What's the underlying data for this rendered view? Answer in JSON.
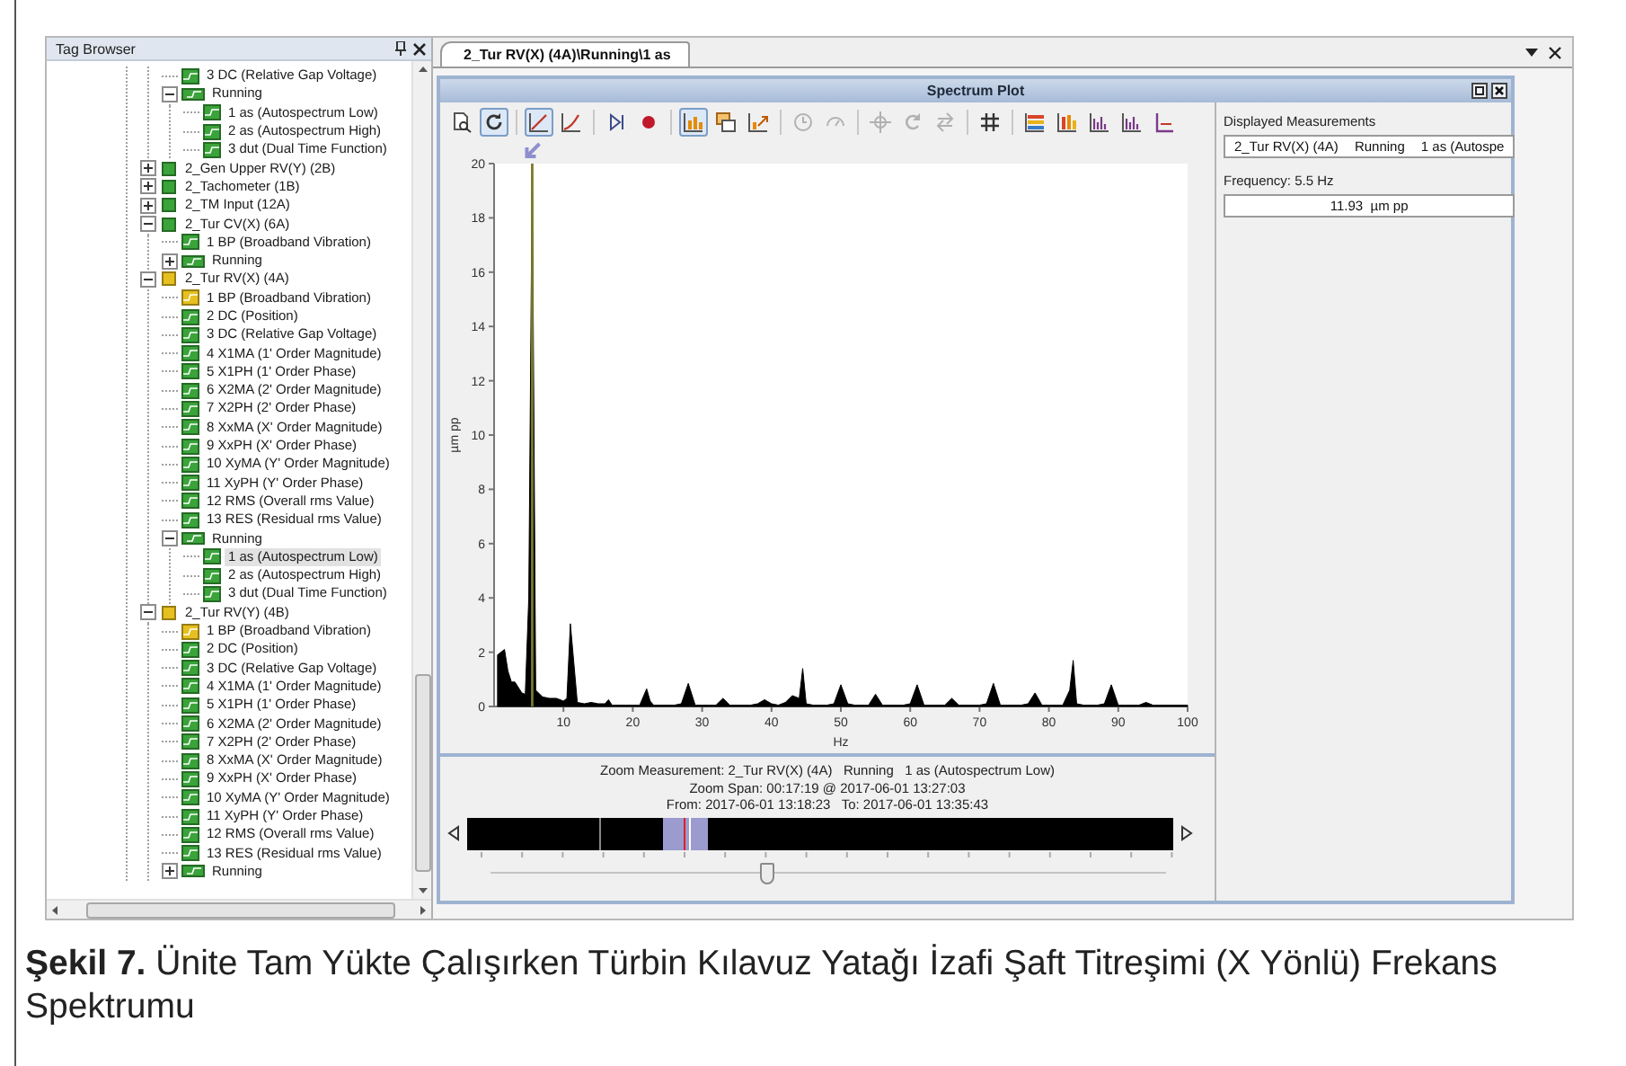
{
  "tag_browser": {
    "title": "Tag Browser",
    "tree": [
      {
        "children": [
          {
            "children": [
              {
                "label": "3 DC (Relative Gap Voltage)",
                "kind": "measurement",
                "color": "#3aa33a",
                "selected": false
              },
              {
                "label": "Running",
                "kind": "state",
                "color": "#3aa33a",
                "expanded": true,
                "selected": false,
                "children": [
                  {
                    "label": "1 as (Autospectrum Low)",
                    "kind": "measurement",
                    "color": "#3aa33a",
                    "selected": false
                  },
                  {
                    "label": "2 as (Autospectrum High)",
                    "kind": "measurement",
                    "color": "#3aa33a",
                    "selected": false
                  },
                  {
                    "label": "3 dut (Dual Time Function)",
                    "kind": "measurement",
                    "color": "#3aa33a",
                    "selected": false
                  }
                ]
              }
            ]
          },
          {
            "label": "2_Gen Upper RV(Y) (2B)",
            "kind": "channel",
            "color": "#3aa33a",
            "expanded": false,
            "selected": false
          },
          {
            "label": "2_Tachometer (1B)",
            "kind": "channel",
            "color": "#3aa33a",
            "expanded": false,
            "selected": false
          },
          {
            "label": "2_TM Input (12A)",
            "kind": "channel",
            "color": "#3aa33a",
            "expanded": false,
            "selected": false
          },
          {
            "label": "2_Tur CV(X) (6A)",
            "kind": "channel",
            "color": "#3aa33a",
            "expanded": true,
            "selected": false,
            "children": [
              {
                "label": "1 BP (Broadband Vibration)",
                "kind": "measurement",
                "color": "#3aa33a",
                "selected": false
              },
              {
                "label": "Running",
                "kind": "state",
                "color": "#3aa33a",
                "expanded": false,
                "selected": false
              }
            ]
          },
          {
            "label": "2_Tur RV(X) (4A)",
            "kind": "channel",
            "color": "#e6c020",
            "expanded": true,
            "selected": false,
            "children": [
              {
                "label": "1 BP (Broadband Vibration)",
                "kind": "measurement",
                "color": "#e6c020",
                "selected": false
              },
              {
                "label": "2 DC (Position)",
                "kind": "measurement",
                "color": "#3aa33a",
                "selected": false
              },
              {
                "label": "3 DC (Relative Gap Voltage)",
                "kind": "measurement",
                "color": "#3aa33a",
                "selected": false
              },
              {
                "label": "4 X1MA (1' Order Magnitude)",
                "kind": "measurement",
                "color": "#3aa33a",
                "selected": false
              },
              {
                "label": "5 X1PH (1' Order Phase)",
                "kind": "measurement",
                "color": "#3aa33a",
                "selected": false
              },
              {
                "label": "6 X2MA (2' Order Magnitude)",
                "kind": "measurement",
                "color": "#3aa33a",
                "selected": false
              },
              {
                "label": "7 X2PH (2' Order Phase)",
                "kind": "measurement",
                "color": "#3aa33a",
                "selected": false
              },
              {
                "label": "8 XxMA (X' Order Magnitude)",
                "kind": "measurement",
                "color": "#3aa33a",
                "selected": false
              },
              {
                "label": "9 XxPH (X' Order Phase)",
                "kind": "measurement",
                "color": "#3aa33a",
                "selected": false
              },
              {
                "label": "10 XyMA (Y' Order Magnitude)",
                "kind": "measurement",
                "color": "#3aa33a",
                "selected": false
              },
              {
                "label": "11 XyPH (Y' Order Phase)",
                "kind": "measurement",
                "color": "#3aa33a",
                "selected": false
              },
              {
                "label": "12 RMS (Overall rms Value)",
                "kind": "measurement",
                "color": "#3aa33a",
                "selected": false
              },
              {
                "label": "13 RES (Residual rms Value)",
                "kind": "measurement",
                "color": "#3aa33a",
                "selected": false
              },
              {
                "label": "Running",
                "kind": "state",
                "color": "#3aa33a",
                "expanded": true,
                "selected": false,
                "children": [
                  {
                    "label": "1 as (Autospectrum Low)",
                    "kind": "measurement",
                    "color": "#3aa33a",
                    "selected": true
                  },
                  {
                    "label": "2 as (Autospectrum High)",
                    "kind": "measurement",
                    "color": "#3aa33a",
                    "selected": false
                  },
                  {
                    "label": "3 dut (Dual Time Function)",
                    "kind": "measurement",
                    "color": "#3aa33a",
                    "selected": false
                  }
                ]
              }
            ]
          },
          {
            "label": "2_Tur RV(Y) (4B)",
            "kind": "channel",
            "color": "#e6c020",
            "expanded": true,
            "selected": false,
            "children": [
              {
                "label": "1 BP (Broadband Vibration)",
                "kind": "measurement",
                "color": "#e6c020",
                "selected": false
              },
              {
                "label": "2 DC (Position)",
                "kind": "measurement",
                "color": "#3aa33a",
                "selected": false
              },
              {
                "label": "3 DC (Relative Gap Voltage)",
                "kind": "measurement",
                "color": "#3aa33a",
                "selected": false
              },
              {
                "label": "4 X1MA (1' Order Magnitude)",
                "kind": "measurement",
                "color": "#3aa33a",
                "selected": false
              },
              {
                "label": "5 X1PH (1' Order Phase)",
                "kind": "measurement",
                "color": "#3aa33a",
                "selected": false
              },
              {
                "label": "6 X2MA (2' Order Magnitude)",
                "kind": "measurement",
                "color": "#3aa33a",
                "selected": false
              },
              {
                "label": "7 X2PH (2' Order Phase)",
                "kind": "measurement",
                "color": "#3aa33a",
                "selected": false
              },
              {
                "label": "8 XxMA (X' Order Magnitude)",
                "kind": "measurement",
                "color": "#3aa33a",
                "selected": false
              },
              {
                "label": "9 XxPH (X' Order Phase)",
                "kind": "measurement",
                "color": "#3aa33a",
                "selected": false
              },
              {
                "label": "10 XyMA (Y' Order Magnitude)",
                "kind": "measurement",
                "color": "#3aa33a",
                "selected": false
              },
              {
                "label": "11 XyPH (Y' Order Phase)",
                "kind": "measurement",
                "color": "#3aa33a",
                "selected": false
              },
              {
                "label": "12 RMS (Overall rms Value)",
                "kind": "measurement",
                "color": "#3aa33a",
                "selected": false
              },
              {
                "label": "13 RES (Residual rms Value)",
                "kind": "measurement",
                "color": "#3aa33a",
                "selected": false
              },
              {
                "label": "Running",
                "kind": "state",
                "color": "#3aa33a",
                "expanded": false,
                "selected": false
              }
            ]
          }
        ]
      }
    ]
  },
  "document_tabs": [
    {
      "label": "2_Tur RV(X) (4A)\\Running\\1 as",
      "selected": true
    }
  ],
  "spectrum_window": {
    "title": "Spectrum Plot",
    "toolbar_groups": [
      [
        {
          "kind": "page-zoom",
          "pressed": false,
          "disabled": false
        },
        {
          "kind": "refresh",
          "pressed": true,
          "disabled": false
        }
      ],
      [
        {
          "kind": "line-chart",
          "pressed": true,
          "disabled": false
        },
        {
          "kind": "curve-chart",
          "pressed": false,
          "disabled": false
        }
      ],
      [
        {
          "kind": "step",
          "pressed": false,
          "disabled": false
        },
        {
          "kind": "record",
          "pressed": false,
          "disabled": false
        }
      ],
      [
        {
          "kind": "bar-chart",
          "pressed": true,
          "disabled": false
        },
        {
          "kind": "windows",
          "pressed": false,
          "disabled": false
        },
        {
          "kind": "export",
          "pressed": false,
          "disabled": false
        }
      ],
      [
        {
          "kind": "clock",
          "pressed": false,
          "disabled": true
        },
        {
          "kind": "gauge",
          "pressed": false,
          "disabled": true
        }
      ],
      [
        {
          "kind": "crosshair",
          "pressed": false,
          "disabled": true
        },
        {
          "kind": "rotate",
          "pressed": false,
          "disabled": true
        },
        {
          "kind": "swap",
          "pressed": false,
          "disabled": true
        }
      ],
      [
        {
          "kind": "grid",
          "pressed": false,
          "disabled": false
        }
      ],
      [
        {
          "kind": "color-bars",
          "pressed": false,
          "disabled": false
        },
        {
          "kind": "waterfall",
          "pressed": false,
          "disabled": false
        },
        {
          "kind": "histogram",
          "pressed": false,
          "disabled": false
        },
        {
          "kind": "histogram",
          "pressed": false,
          "disabled": false
        },
        {
          "kind": "axes",
          "pressed": false,
          "disabled": false
        }
      ]
    ],
    "chart_data": {
      "type": "area",
      "xlabel": "Hz",
      "ylabel": "µm pp",
      "xlim": [
        0,
        100
      ],
      "ylim": [
        0,
        20
      ],
      "xticks": [
        10,
        20,
        30,
        40,
        50,
        60,
        70,
        80,
        90,
        100
      ],
      "yticks": [
        0,
        2,
        4,
        6,
        8,
        10,
        12,
        14,
        16,
        18,
        20
      ],
      "x": [
        0.5,
        1,
        1.5,
        2,
        2.5,
        3,
        3.5,
        4,
        4.5,
        5,
        5.5,
        6,
        7,
        8,
        9,
        10,
        10.5,
        11,
        11.5,
        12,
        13,
        14,
        15,
        16,
        16.5,
        17,
        18,
        19,
        20,
        21,
        22,
        22.5,
        23,
        24,
        25,
        26,
        27,
        28,
        29,
        30,
        31,
        32,
        33,
        34,
        35,
        36,
        37,
        38,
        39,
        40,
        41,
        42,
        43,
        44,
        44.5,
        45,
        46,
        47,
        48,
        49,
        50,
        51,
        52,
        53,
        54,
        55,
        56,
        57,
        58,
        59,
        60,
        61,
        62,
        63,
        64,
        65,
        66,
        67,
        68,
        69,
        70,
        71,
        72,
        73,
        74,
        75,
        76,
        77,
        78,
        79,
        80,
        81,
        82,
        83,
        83.5,
        84,
        85,
        86,
        87,
        88,
        89,
        90,
        91,
        92,
        93,
        94,
        95,
        96,
        97,
        98,
        99,
        100
      ],
      "values": [
        1.9,
        2.0,
        2.1,
        1.3,
        0.9,
        0.9,
        0.7,
        0.5,
        0.45,
        4.0,
        20,
        0.6,
        0.35,
        0.3,
        0.3,
        0.2,
        0.3,
        3.05,
        1.6,
        0.15,
        0.1,
        0.15,
        0.1,
        0.1,
        0.25,
        0.05,
        0.05,
        0.05,
        0.05,
        0.05,
        0.65,
        0.2,
        0.05,
        0.05,
        0.05,
        0.05,
        0.1,
        0.85,
        0.05,
        0.05,
        0.05,
        0.05,
        0.3,
        0.05,
        0.05,
        0.05,
        0.05,
        0.1,
        0.25,
        0.1,
        0.05,
        0.15,
        0.4,
        0.3,
        1.4,
        0.1,
        0.05,
        0.05,
        0.05,
        0.1,
        0.8,
        0.1,
        0.05,
        0.05,
        0.05,
        0.45,
        0.05,
        0.05,
        0.05,
        0.05,
        0.1,
        0.8,
        0.05,
        0.05,
        0.05,
        0.05,
        0.3,
        0.05,
        0.05,
        0.05,
        0.05,
        0.1,
        0.85,
        0.05,
        0.05,
        0.05,
        0.05,
        0.1,
        0.5,
        0.05,
        0.05,
        0.05,
        0.05,
        0.6,
        1.7,
        0.1,
        0.05,
        0.05,
        0.05,
        0.1,
        0.8,
        0.05,
        0.05,
        0.05,
        0.05,
        0.15,
        0.05,
        0.05,
        0.05,
        0.05,
        0.05,
        0.05
      ],
      "ref_lines": [
        {
          "axis": "x",
          "value": 5.5
        }
      ]
    },
    "zoom": {
      "lines": [
        "Zoom Measurement: 2_Tur RV(X) (4A)   Running   1 as (Autospectrum Low)",
        "Zoom Span: 00:17:19 @ 2017-06-01 13:27:03",
        "From: 2017-06-01 13:18:23   To: 2017-06-01 13:35:43"
      ],
      "slider": {
        "level": 0.41
      }
    },
    "side_panel": {
      "measurements_label": "Displayed Measurements",
      "measurement": [
        "2_Tur RV(X) (4A)",
        "Running",
        "1 as (Autospe"
      ],
      "frequency_label": "Frequency: 5.5 Hz",
      "value": "11.93  µm pp"
    }
  },
  "caption": "**Şekil 7.** Ünite Tam Yükte Çalışırken Türbin Kılavuz Yatağı İzafi Şaft Titreşimi (X Yönlü) Frekans Spektrumu"
}
